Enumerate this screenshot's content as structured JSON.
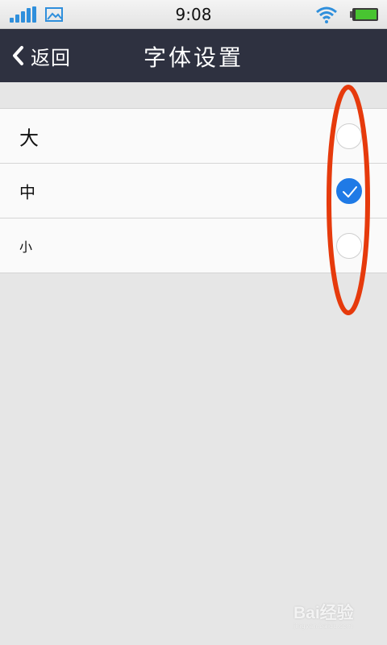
{
  "status_bar": {
    "time": "9:08",
    "icons": [
      "signal-icon",
      "gallery-icon",
      "wifi-icon",
      "battery-icon"
    ]
  },
  "nav": {
    "back_label": "返回",
    "title": "字体设置"
  },
  "options": [
    {
      "label": "大",
      "checked": false
    },
    {
      "label": "中",
      "checked": true
    },
    {
      "label": "小",
      "checked": false
    }
  ],
  "colors": {
    "nav_background": "#2e3140",
    "accent": "#1f7ae6",
    "annotation": "#e63a0c",
    "page_background": "#e6e6e6"
  },
  "watermark": {
    "main": "Bai经验",
    "sub": "jingyan.baidu.com"
  }
}
